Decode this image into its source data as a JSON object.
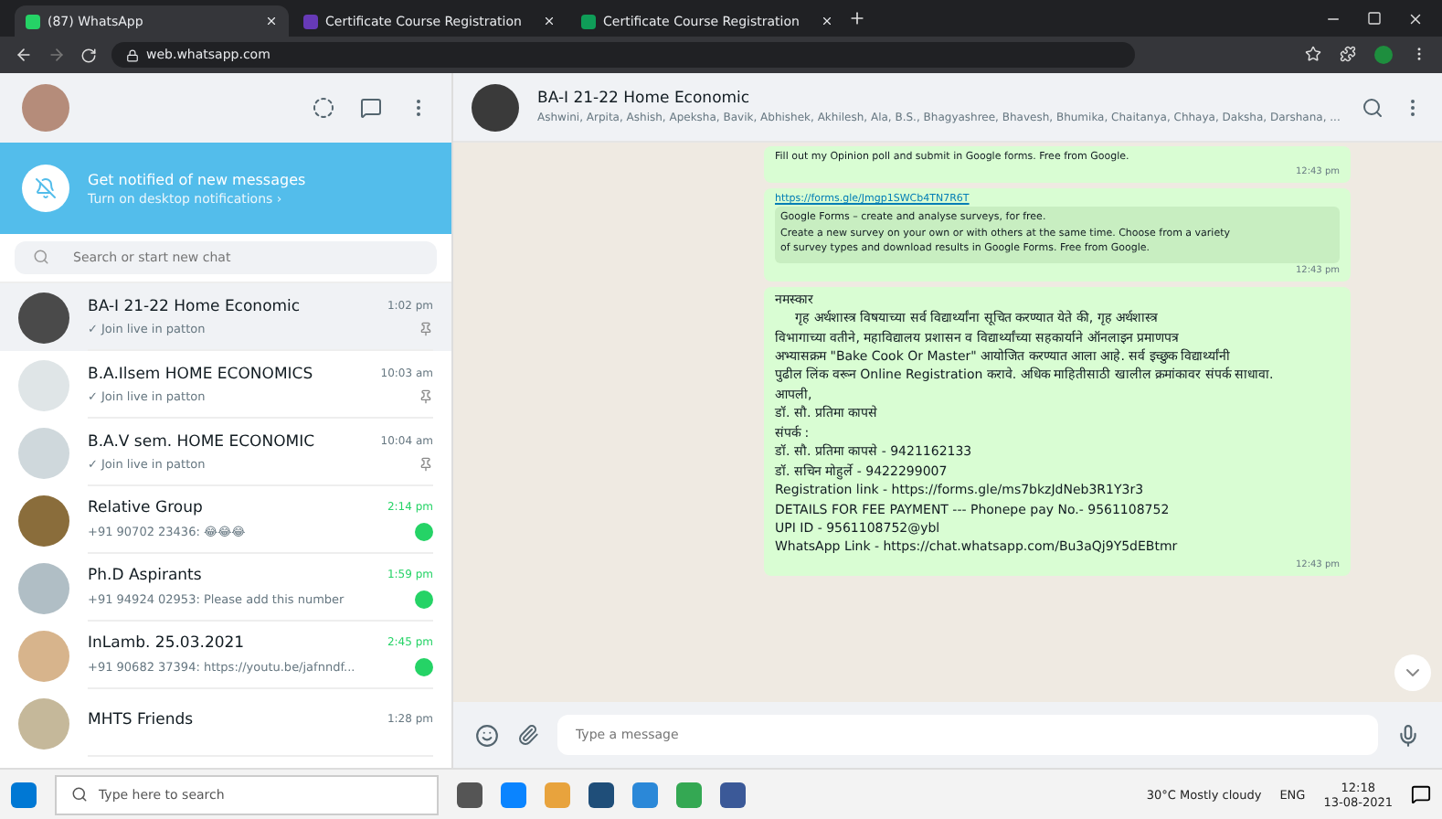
{
  "browser": {
    "tabs": [
      {
        "title": "(87) WhatsApp",
        "selected": true,
        "color": "#25d366"
      },
      {
        "title": "Certificate Course Registration",
        "selected": false,
        "color": "#673ab7"
      },
      {
        "title": "Certificate Course Registration",
        "selected": false,
        "color": "#0f9d58"
      }
    ],
    "url": "web.whatsapp.com"
  },
  "sidebar": {
    "banner": {
      "title": "Get notified of new messages",
      "subtitle": "Turn on desktop notifications ›"
    },
    "search": {
      "placeholder": "Search or start new chat"
    },
    "chats": [
      {
        "name": "BA-I 21-22 Home Economic",
        "preview": "✓ Join live in patton",
        "time": "1:02 pm",
        "pinned": true,
        "unread": false,
        "selected": true
      },
      {
        "name": "B.A.Ilsem HOME ECONOMICS",
        "preview": "✓ Join live in patton",
        "time": "10:03 am",
        "pinned": true,
        "unread": false,
        "selected": false
      },
      {
        "name": "B.A.V sem. HOME ECONOMIC",
        "preview": "✓ Join live in patton",
        "time": "10:04 am",
        "pinned": true,
        "unread": false,
        "selected": false
      },
      {
        "name": "Relative Group",
        "preview": "+91 90702 23436:",
        "time": "2:14 pm",
        "pinned": false,
        "unread": true,
        "selected": false,
        "emoji": "😂😂😂"
      },
      {
        "name": "Ph.D Aspirants",
        "preview": "+91 94924 02953: Please add this number",
        "time": "1:59 pm",
        "pinned": false,
        "unread": true,
        "selected": false
      },
      {
        "name": "InLamb. 25.03.2021",
        "preview": "+91 90682 37394: https://youtu.be/jafnndf...",
        "time": "2:45 pm",
        "pinned": false,
        "unread": true,
        "selected": false
      },
      {
        "name": "MHTS Friends",
        "time": "1:28 pm",
        "selected": false
      }
    ]
  },
  "chat": {
    "title": "BA-I 21-22 Home Economic",
    "members": "Ashwini, Arpita, Ashish, Apeksha, Bavik, Abhishek, Akhilesh, Ala, B.S., Bhagyashree, Bhavesh, Bhumika, Chaitanya, Chhaya, Daksha, Darshana, ...",
    "messages": [
      {
        "kind": "text",
        "lines": [
          "Fill out my Opinion poll and submit in Google forms. Free from Google."
        ],
        "time": "12:43 pm"
      },
      {
        "kind": "link",
        "lines": [
          "Google Forms – create and analyse surveys, for free.",
          "Create a new survey on your own or with others at the same time. Choose from a variety",
          "of survey types and download results in Google Forms. Free from Google."
        ],
        "link": "https://forms.gle/Jmgp1SWCb4TN7R6T",
        "time": "12:43 pm"
      },
      {
        "kind": "text",
        "lines": [
          "नमस्कार",
          "     गृह अर्थशास्त्र विषयाच्या सर्व विद्यार्थ्यांना सूचित करण्यात येते की, गृह अर्थशास्त्र",
          "विभागाच्या वतीने, महाविद्यालय प्रशासन व विद्यार्थ्यांच्या सहकार्याने ऑनलाइन प्रमाणपत्र",
          "अभ्यासक्रम \"Bake Cook Or Master\" आयोजित करण्यात आला आहे. सर्व इच्छुक विद्यार्थ्यांनी",
          "पुढील लिंक वरून Online Registration करावे. अधिक माहितीसाठी खालील क्रमांकावर संपर्क साधावा.",
          "आपली,",
          "डॉ. सौ. प्रतिमा कापसे",
          "संपर्क :",
          "डॉ. सौ. प्रतिमा कापसे - 9421162133",
          "डॉ. सचिन मोहुर्ले - 9422299007",
          "Registration link - https://forms.gle/ms7bkzJdNeb3R1Y3r3",
          "DETAILS FOR FEE PAYMENT --- Phonepe pay No.- 9561108752",
          "UPI ID - 9561108752@ybl",
          "WhatsApp Link - https://chat.whatsapp.com/Bu3aQj9Y5dEBtmr"
        ],
        "time": "12:43 pm"
      }
    ],
    "composer": {
      "placeholder": "Type a message"
    }
  },
  "taskbar": {
    "search": "Type here to search",
    "weather": "30°C Mostly cloudy",
    "lang": "ENG",
    "time": "12:18",
    "date": "13-08-2021"
  }
}
